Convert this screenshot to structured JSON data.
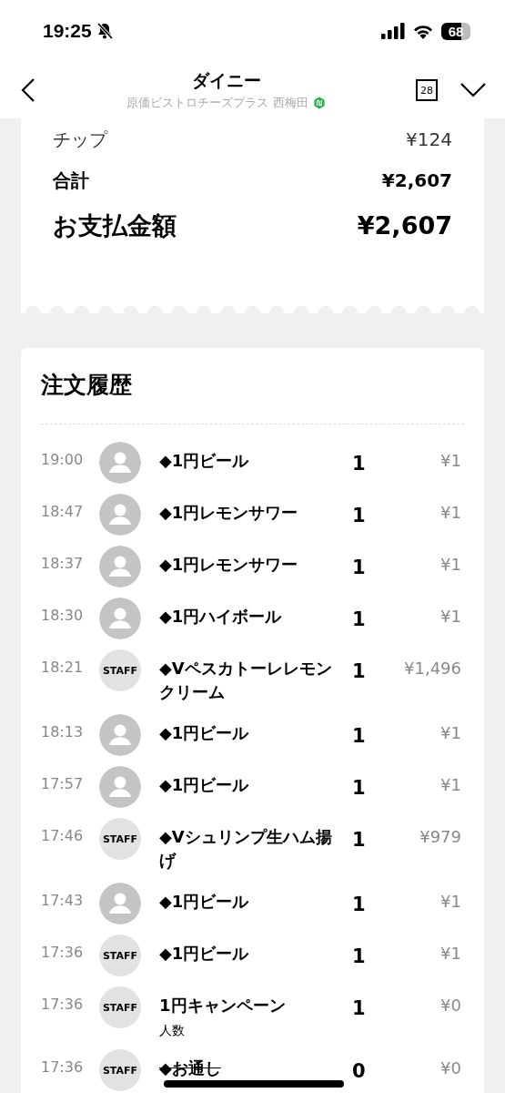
{
  "status_bar": {
    "time": "19:25",
    "silent": true,
    "battery": "68"
  },
  "header": {
    "title": "ダイニー",
    "subtitle": "原価ビストロチーズプラス 西梅田",
    "calendar_day": "28"
  },
  "summary": [
    {
      "label": "チップ",
      "amount": "¥124",
      "kind": "normal"
    },
    {
      "label": "合計",
      "amount": "¥2,607",
      "kind": "bold"
    },
    {
      "label": "お支払金額",
      "amount": "¥2,607",
      "kind": "large"
    }
  ],
  "history": {
    "title": "注文履歴",
    "orders": [
      {
        "time": "19:00",
        "kind": "user",
        "name": "◆1円ビール",
        "qty": "1",
        "price": "¥1",
        "cancelled": false
      },
      {
        "time": "18:47",
        "kind": "user",
        "name": "◆1円レモンサワー",
        "qty": "1",
        "price": "¥1",
        "cancelled": false
      },
      {
        "time": "18:37",
        "kind": "user",
        "name": "◆1円レモンサワー",
        "qty": "1",
        "price": "¥1",
        "cancelled": false
      },
      {
        "time": "18:30",
        "kind": "user",
        "name": "◆1円ハイボール",
        "qty": "1",
        "price": "¥1",
        "cancelled": false
      },
      {
        "time": "18:21",
        "kind": "staff",
        "avatar_label": "STAFF",
        "name": "◆Vペスカトーレレモンクリーム",
        "qty": "1",
        "price": "¥1,496",
        "cancelled": false
      },
      {
        "time": "18:13",
        "kind": "user",
        "name": "◆1円ビール",
        "qty": "1",
        "price": "¥1",
        "cancelled": false
      },
      {
        "time": "17:57",
        "kind": "user",
        "name": "◆1円ビール",
        "qty": "1",
        "price": "¥1",
        "cancelled": false
      },
      {
        "time": "17:46",
        "kind": "staff",
        "avatar_label": "STAFF",
        "name": "◆Vシュリンプ生ハム揚げ",
        "qty": "1",
        "price": "¥979",
        "cancelled": false
      },
      {
        "time": "17:43",
        "kind": "user",
        "name": "◆1円ビール",
        "qty": "1",
        "price": "¥1",
        "cancelled": false
      },
      {
        "time": "17:36",
        "kind": "staff",
        "avatar_label": "STAFF",
        "name": "◆1円ビール",
        "qty": "1",
        "price": "¥1",
        "cancelled": false
      },
      {
        "time": "17:36",
        "kind": "staff",
        "avatar_label": "STAFF",
        "name": "1円キャンペーン",
        "note": "人数",
        "qty": "1",
        "price": "¥0",
        "cancelled": false
      },
      {
        "time": "17:36",
        "kind": "staff",
        "avatar_label": "STAFF",
        "name": "◆お通し",
        "qty": "0",
        "price": "¥0",
        "cancelled": true
      }
    ]
  }
}
